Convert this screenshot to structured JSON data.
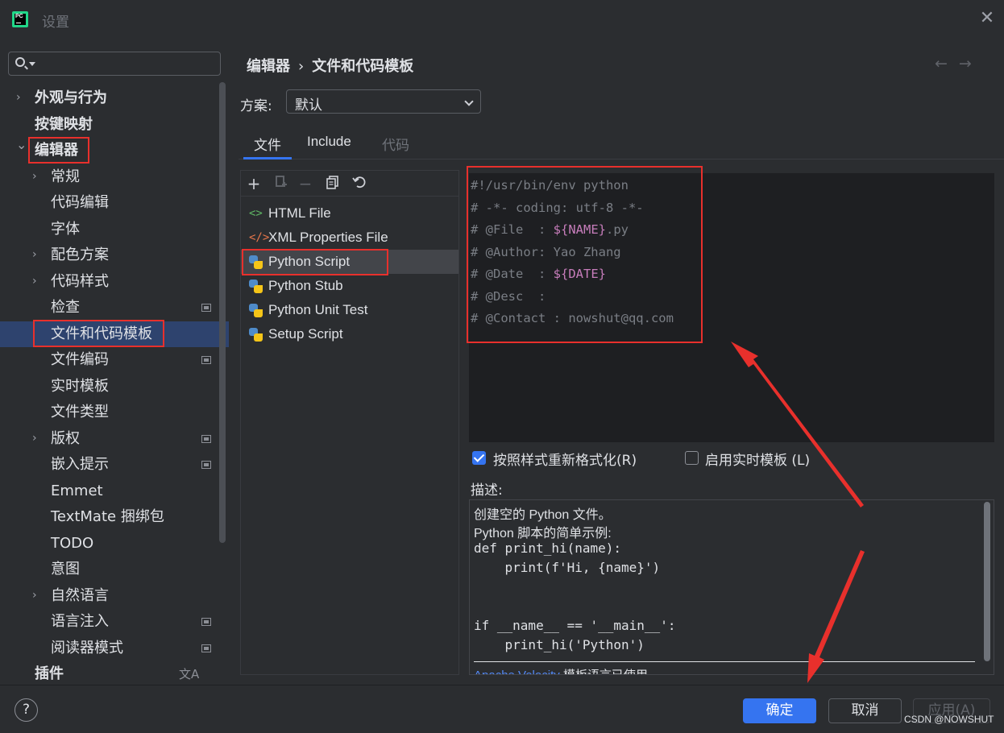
{
  "window": {
    "title": "设置",
    "close_icon": "close-icon"
  },
  "sidebar": {
    "search_placeholder": "",
    "items": [
      {
        "label": "外观与行为",
        "level": 0,
        "chevron": "right",
        "bold": true,
        "marker": false
      },
      {
        "label": "按键映射",
        "level": 0,
        "chevron": "",
        "bold": true,
        "marker": false
      },
      {
        "label": "编辑器",
        "level": 0,
        "chevron": "down",
        "bold": true,
        "marker": false
      },
      {
        "label": "常规",
        "level": 1,
        "chevron": "right",
        "bold": false,
        "marker": false
      },
      {
        "label": "代码编辑",
        "level": 1,
        "chevron": "",
        "bold": false,
        "marker": false
      },
      {
        "label": "字体",
        "level": 1,
        "chevron": "",
        "bold": false,
        "marker": false
      },
      {
        "label": "配色方案",
        "level": 1,
        "chevron": "right",
        "bold": false,
        "marker": false
      },
      {
        "label": "代码样式",
        "level": 1,
        "chevron": "right",
        "bold": false,
        "marker": false
      },
      {
        "label": "检查",
        "level": 1,
        "chevron": "",
        "bold": false,
        "marker": true
      },
      {
        "label": "文件和代码模板",
        "level": 1,
        "chevron": "",
        "bold": false,
        "marker": false,
        "selected": true
      },
      {
        "label": "文件编码",
        "level": 1,
        "chevron": "",
        "bold": false,
        "marker": true
      },
      {
        "label": "实时模板",
        "level": 1,
        "chevron": "",
        "bold": false,
        "marker": false
      },
      {
        "label": "文件类型",
        "level": 1,
        "chevron": "",
        "bold": false,
        "marker": false
      },
      {
        "label": "版权",
        "level": 1,
        "chevron": "right",
        "bold": false,
        "marker": true
      },
      {
        "label": "嵌入提示",
        "level": 1,
        "chevron": "",
        "bold": false,
        "marker": true
      },
      {
        "label": "Emmet",
        "level": 1,
        "chevron": "",
        "bold": false,
        "marker": false
      },
      {
        "label": "TextMate 捆绑包",
        "level": 1,
        "chevron": "",
        "bold": false,
        "marker": false
      },
      {
        "label": "TODO",
        "level": 1,
        "chevron": "",
        "bold": false,
        "marker": false
      },
      {
        "label": "意图",
        "level": 1,
        "chevron": "",
        "bold": false,
        "marker": false
      },
      {
        "label": "自然语言",
        "level": 1,
        "chevron": "right",
        "bold": false,
        "marker": false
      },
      {
        "label": "语言注入",
        "level": 1,
        "chevron": "",
        "bold": false,
        "marker": true
      },
      {
        "label": "阅读器模式",
        "level": 1,
        "chevron": "",
        "bold": false,
        "marker": true
      },
      {
        "label": "插件",
        "level": 0,
        "chevron": "",
        "bold": true,
        "marker": false,
        "lang_icon": "文A"
      }
    ]
  },
  "header": {
    "breadcrumb_parent": "编辑器",
    "breadcrumb_sep": "›",
    "breadcrumb_current": "文件和代码模板",
    "back_icon": "←",
    "forward_icon": "→"
  },
  "scheme": {
    "label": "方案:",
    "value": "默认"
  },
  "tabs": [
    {
      "label": "文件",
      "state": "active"
    },
    {
      "label": "Include",
      "state": "normal"
    },
    {
      "label": "代码",
      "state": "disabled"
    }
  ],
  "toolbar_icons": [
    "add-icon",
    "copy-add-icon",
    "remove-icon",
    "duplicate-icon",
    "reset-icon"
  ],
  "templates": [
    {
      "label": "HTML File",
      "icon": "html-icon",
      "glyph": "<>",
      "color": "#5fb865"
    },
    {
      "label": "XML Properties File",
      "icon": "xml-icon",
      "glyph": "</>",
      "color": "#e8774b"
    },
    {
      "label": "Python Script",
      "icon": "python-icon",
      "selected": true
    },
    {
      "label": "Python Stub",
      "icon": "python-icon"
    },
    {
      "label": "Python Unit Test",
      "icon": "python-icon"
    },
    {
      "label": "Setup Script",
      "icon": "python-icon"
    }
  ],
  "editor": {
    "lines": [
      {
        "pre": "#!/usr/bin/env python",
        "var": "",
        "post": ""
      },
      {
        "pre": "# -*- coding: utf-8 -*-",
        "var": "",
        "post": ""
      },
      {
        "pre": "# @File  : ",
        "var": "${NAME}",
        "post": ".py"
      },
      {
        "pre": "# @Author: Yao Zhang",
        "var": "",
        "post": ""
      },
      {
        "pre": "# @Date  : ",
        "var": "${DATE}",
        "post": ""
      },
      {
        "pre": "# @Desc  :",
        "var": "",
        "post": ""
      },
      {
        "pre": "# @Contact : nowshut@qq.com",
        "var": "",
        "post": ""
      }
    ]
  },
  "options": {
    "reformat_label": "按照样式重新格式化(R)",
    "reformat_checked": true,
    "live_template_label": "启用实时模板 (L)",
    "live_template_checked": false
  },
  "description": {
    "label": "描述:",
    "line1": "创建空的 Python 文件。",
    "line2": "Python 脚本的简单示例:",
    "code": [
      "def print_hi(name):",
      "    print(f'Hi, {name}')",
      "",
      "",
      "if __name__ == '__main__':",
      "    print_hi('Python')"
    ],
    "footer_link": "Apache Velocity",
    "footer_text": " 模板语言已使用"
  },
  "footer": {
    "help": "?",
    "ok": "确定",
    "cancel": "取消",
    "apply": "应用(A)",
    "watermark": "CSDN @NOWSHUT"
  },
  "colors": {
    "accent": "#3574f0",
    "annotation_red": "#e8302c",
    "selected_row": "#2e436e"
  }
}
